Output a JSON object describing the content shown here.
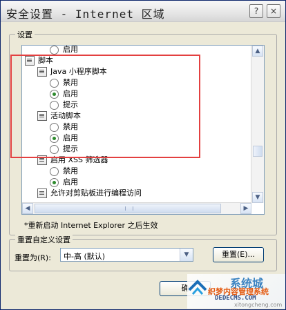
{
  "window": {
    "title": "安全设置 - Internet 区域",
    "help_glyph": "?",
    "close_glyph": "×"
  },
  "settings_group": {
    "label": "设置",
    "items": [
      {
        "kind": "radio",
        "label": "启用",
        "checked": false,
        "level": 2
      },
      {
        "kind": "header",
        "label": "脚本",
        "level": 0
      },
      {
        "kind": "header",
        "label": "Java 小程序脚本",
        "level": 1
      },
      {
        "kind": "radio",
        "label": "禁用",
        "checked": false,
        "level": 2
      },
      {
        "kind": "radio",
        "label": "启用",
        "checked": true,
        "level": 2
      },
      {
        "kind": "radio",
        "label": "提示",
        "checked": false,
        "level": 2
      },
      {
        "kind": "header",
        "label": "活动脚本",
        "level": 1
      },
      {
        "kind": "radio",
        "label": "禁用",
        "checked": false,
        "level": 2
      },
      {
        "kind": "radio",
        "label": "启用",
        "checked": true,
        "level": 2
      },
      {
        "kind": "radio",
        "label": "提示",
        "checked": false,
        "level": 2
      },
      {
        "kind": "header",
        "label": "启用 XSS 筛选器",
        "level": 1
      },
      {
        "kind": "radio",
        "label": "禁用",
        "checked": false,
        "level": 2
      },
      {
        "kind": "radio",
        "label": "启用",
        "checked": true,
        "level": 2
      },
      {
        "kind": "header",
        "label": "允许对剪贴板进行编程访问",
        "level": 1
      }
    ]
  },
  "note": "*重新启动 Internet Explorer 之后生效",
  "reset_group": {
    "label": "重置自定义设置",
    "reset_to_label": "重置为(R):",
    "selected_level": "中-高 (默认)",
    "reset_button": "重置(E)..."
  },
  "ok_button_partial": "确",
  "watermark": {
    "brand": "系统城",
    "cn_text": "织梦内容管理系统",
    "dede": "DEDECMS.COM",
    "url": "xitongcheng.com"
  },
  "colors": {
    "highlight_box": "#e34040",
    "radio_checked": "#2d8a2d"
  }
}
